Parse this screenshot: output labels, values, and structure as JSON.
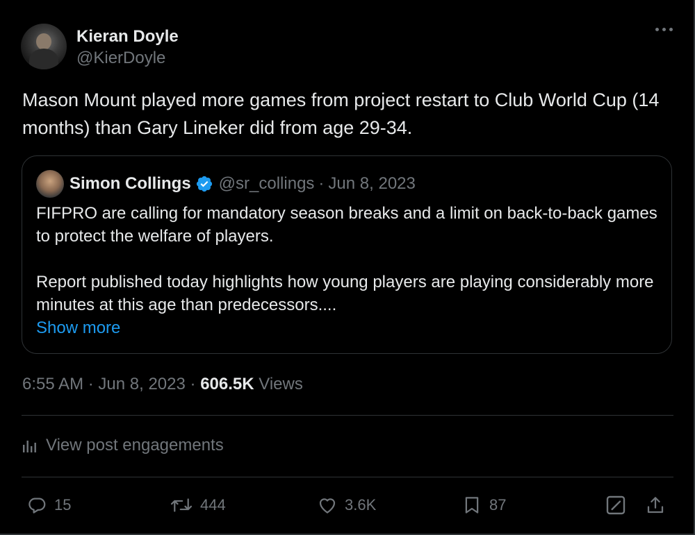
{
  "author": {
    "display_name": "Kieran Doyle",
    "handle": "@KierDoyle"
  },
  "tweet": {
    "text": "Mason Mount played more games from project restart to Club World Cup (14 months) than Gary Lineker did from age 29-34."
  },
  "quoted": {
    "display_name": "Simon Collings",
    "handle": "@sr_collings",
    "separator": "·",
    "date": "Jun 8, 2023",
    "paragraph1": "FIFPRO are calling for mandatory season breaks and a limit on back-to-back games to protect the welfare of players.",
    "paragraph2": "Report published today highlights how young players are playing considerably more minutes at this age than predecessors....",
    "show_more": "Show more"
  },
  "meta": {
    "time": "6:55 AM",
    "separator": "·",
    "date": "Jun 8, 2023",
    "views_count": "606.5K",
    "views_label": "Views"
  },
  "engagements_label": "View post engagements",
  "actions": {
    "replies": "15",
    "reposts": "444",
    "likes": "3.6K",
    "bookmarks": "87"
  },
  "colors": {
    "background": "#000000",
    "text": "#e7e9ea",
    "muted": "#71767b",
    "link": "#1d9bf0",
    "border": "#2f3336",
    "verified": "#1d9bf0"
  },
  "icons": {
    "more": "more-horizontal-icon",
    "verified": "verified-badge-icon",
    "engagements": "analytics-bars-icon",
    "reply": "reply-bubble-icon",
    "repost": "repost-arrows-icon",
    "like": "heart-icon",
    "bookmark": "bookmark-icon",
    "grok": "edit-square-icon",
    "share": "share-upload-icon"
  }
}
